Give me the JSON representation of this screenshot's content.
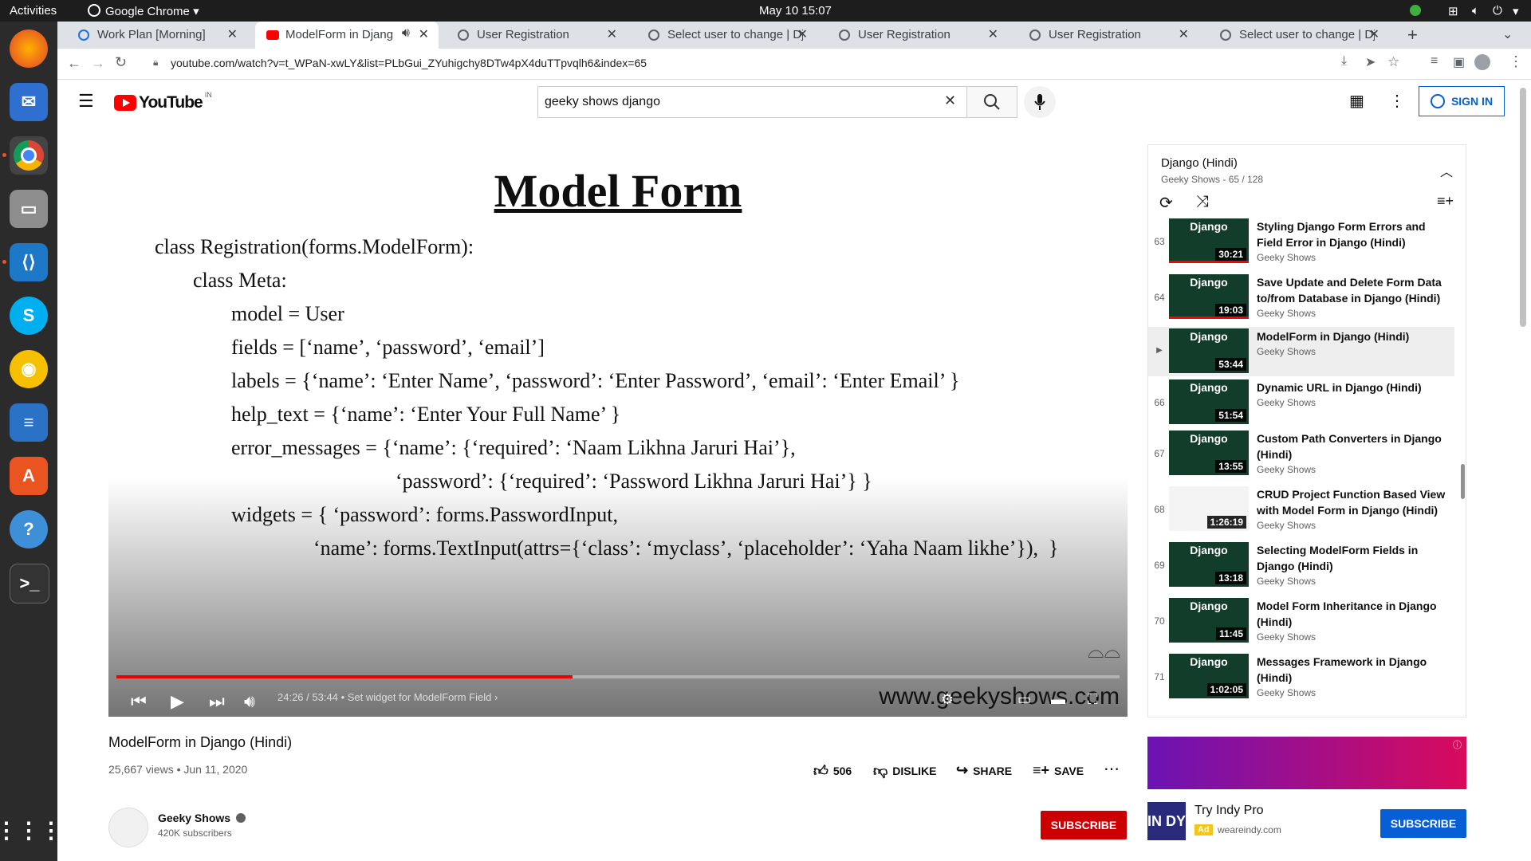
{
  "os": {
    "activities": "Activities",
    "app_name": "Google Chrome",
    "clock": "May 10  15:07"
  },
  "tabs": [
    {
      "label": "Work Plan [Morning]",
      "active": false
    },
    {
      "label": "ModelForm in Djang",
      "active": true
    },
    {
      "label": "User Registration",
      "active": false
    },
    {
      "label": "Select user to change | Dj",
      "active": false
    },
    {
      "label": "User Registration",
      "active": false
    },
    {
      "label": "User Registration",
      "active": false
    },
    {
      "label": "Select user to change | Dj",
      "active": false
    }
  ],
  "address": {
    "url": "youtube.com/watch?v=t_WPaN-xwLY&list=PLbGui_ZYuhigchy8DTw4pX4duTTpvqlh6&index=65"
  },
  "youtube": {
    "logo_text": "YouTube",
    "region": "IN",
    "search_value": "geeky shows django",
    "signin_label": "SIGN IN"
  },
  "slide": {
    "title": "Model Form",
    "lines": [
      "class Registration(forms.ModelForm):",
      "class Meta:",
      "model = User",
      "fields = [‘name’, ‘password’, ‘email’]",
      "labels = {‘name’: ‘Enter Name’, ‘password’: ‘Enter Password’, ‘email’: ‘Enter Email’ }",
      "help_text = {‘name’: ‘Enter Your Full Name’ }",
      "error_messages = {‘name’: {‘required’: ‘Naam Likhna Jaruri Hai’},",
      "‘password’: {‘required’: ‘Password Likhna Jaruri Hai’} }",
      "widgets = { ‘password’: forms.PasswordInput,",
      "‘name’: forms.TextInput(attrs={‘class’: ‘myclass’, ‘placeholder’: ‘Yaha Naam likhe’}),  }"
    ],
    "watermark": "www.geekyshows.com"
  },
  "player": {
    "current_time": "24:26",
    "duration": "53:44",
    "chapter": "Set widget for ModelForm Field",
    "progress_fraction": 0.455
  },
  "video": {
    "title": "ModelForm in Django (Hindi)",
    "meta": "25,667 views • Jun 11, 2020",
    "likes": "506",
    "dislike_label": "DISLIKE",
    "share_label": "SHARE",
    "save_label": "SAVE"
  },
  "channel": {
    "name": "Geeky Shows",
    "subscribers": "420K subscribers",
    "subscribe_label": "SUBSCRIBE"
  },
  "playlist": {
    "title": "Django (Hindi)",
    "subtitle": "Geeky Shows - 65 / 128",
    "items": [
      {
        "index": "63",
        "title": "Styling Django Form Errors and Field Error in Django (Hindi)",
        "channel": "Geeky Shows",
        "duration": "30:21",
        "thumb_label": "Django",
        "watched": 1.0
      },
      {
        "index": "64",
        "title": "Save Update and Delete Form Data to/from Database in Django (Hindi)",
        "channel": "Geeky Shows",
        "duration": "19:03",
        "thumb_label": "Django",
        "watched": 1.0
      },
      {
        "index": "▶",
        "title": "ModelForm in Django (Hindi)",
        "channel": "Geeky Shows",
        "duration": "53:44",
        "thumb_label": "Django",
        "watched": 0,
        "current": true
      },
      {
        "index": "66",
        "title": "Dynamic URL in Django (Hindi)",
        "channel": "Geeky Shows",
        "duration": "51:54",
        "thumb_label": "Django",
        "watched": 0
      },
      {
        "index": "67",
        "title": "Custom Path Converters in Django (Hindi)",
        "channel": "Geeky Shows",
        "duration": "13:55",
        "thumb_label": "Django",
        "watched": 0
      },
      {
        "index": "68",
        "title": "CRUD Project Function Based View with Model Form in Django (Hindi)",
        "channel": "Geeky Shows",
        "duration": "1:26:19",
        "thumb_label": "",
        "watched": 0
      },
      {
        "index": "69",
        "title": "Selecting ModelForm Fields in Django (Hindi)",
        "channel": "Geeky Shows",
        "duration": "13:18",
        "thumb_label": "Django",
        "watched": 0
      },
      {
        "index": "70",
        "title": "Model Form Inheritance in Django (Hindi)",
        "channel": "Geeky Shows",
        "duration": "11:45",
        "thumb_label": "Django",
        "watched": 0
      },
      {
        "index": "71",
        "title": "Messages Framework in Django (Hindi)",
        "channel": "Geeky Shows",
        "duration": "1:02:05",
        "thumb_label": "Django",
        "watched": 0
      }
    ]
  },
  "ad": {
    "logo": "IN DY",
    "title": "Try Indy Pro",
    "badge": "Ad",
    "domain": "weareindy.com",
    "subscribe_label": "SUBSCRIBE"
  },
  "colors": {
    "youtube_red": "#ff0000",
    "subscribe_red": "#cc0000",
    "link_blue": "#065fd4",
    "ubuntu_orange": "#e95420"
  }
}
